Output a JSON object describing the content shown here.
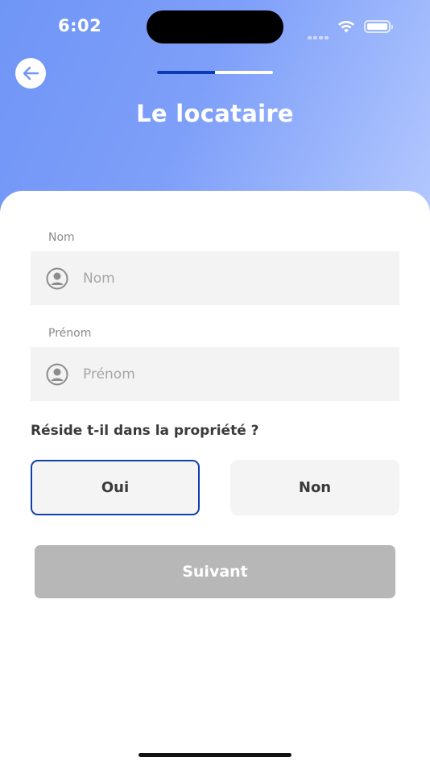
{
  "status_bar": {
    "time": "6:02"
  },
  "header": {
    "title": "Le locataire",
    "progress_fraction": 0.5,
    "colors": {
      "progress_active": "#0b3bb8",
      "gradient_start": "#6f95f6",
      "gradient_end": "#b4c9fe"
    },
    "back_icon": "arrow-left-icon"
  },
  "form": {
    "nom": {
      "label": "Nom",
      "placeholder": "Nom",
      "value": "",
      "icon": "user-circle-icon"
    },
    "prenom": {
      "label": "Prénom",
      "placeholder": "Prénom",
      "value": "",
      "icon": "user-circle-icon"
    },
    "question": "Réside t-il dans la propriété ?",
    "choices": [
      {
        "label": "Oui",
        "selected": true
      },
      {
        "label": "Non",
        "selected": false
      }
    ],
    "selected_border_color": "#0f3fae"
  },
  "actions": {
    "next_label": "Suivant",
    "next_enabled": false,
    "next_color": "#b7b7b7"
  }
}
